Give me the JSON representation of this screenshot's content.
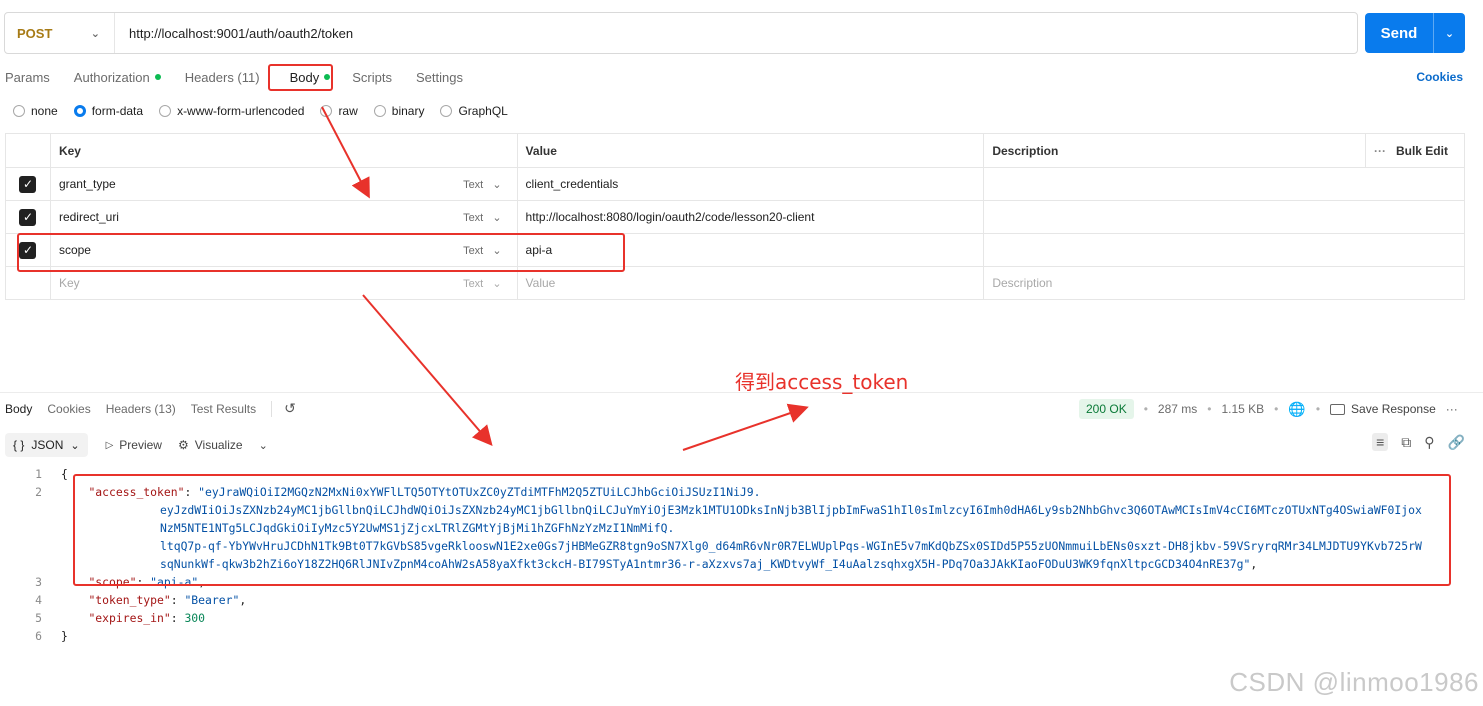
{
  "request": {
    "method": "POST",
    "url": "http://localhost:9001/auth/oauth2/token",
    "send_label": "Send"
  },
  "request_tabs": [
    {
      "label": "Params",
      "dot": false
    },
    {
      "label": "Authorization",
      "dot": true
    },
    {
      "label": "Headers (11)",
      "dot": false
    },
    {
      "label": "Body",
      "dot": true
    },
    {
      "label": "Scripts",
      "dot": false
    },
    {
      "label": "Settings",
      "dot": false
    }
  ],
  "cookies_label": "Cookies",
  "body_types": [
    {
      "label": "none",
      "selected": false
    },
    {
      "label": "form-data",
      "selected": true
    },
    {
      "label": "x-www-form-urlencoded",
      "selected": false
    },
    {
      "label": "raw",
      "selected": false
    },
    {
      "label": "binary",
      "selected": false
    },
    {
      "label": "GraphQL",
      "selected": false
    }
  ],
  "params_table": {
    "headers": {
      "key": "Key",
      "value": "Value",
      "description": "Description",
      "bulk_edit": "Bulk Edit"
    },
    "rows": [
      {
        "key": "grant_type",
        "type": "Text",
        "value": "client_credentials"
      },
      {
        "key": "redirect_uri",
        "type": "Text",
        "value": "http://localhost:8080/login/oauth2/code/lesson20-client"
      },
      {
        "key": "scope",
        "type": "Text",
        "value": "api-a"
      }
    ],
    "placeholder": {
      "key": "Key",
      "type": "Text",
      "value": "Value",
      "description": "Description"
    }
  },
  "annotation": "得到access_token",
  "response": {
    "tabs": [
      "Body",
      "Cookies",
      "Headers (13)",
      "Test Results"
    ],
    "status": "200 OK",
    "time": "287 ms",
    "size": "1.15 KB",
    "save_label": "Save Response",
    "format": "JSON",
    "preview_label": "Preview",
    "visualize_label": "Visualize",
    "json_lines": {
      "l1": "{",
      "l2_key": "\"access_token\"",
      "l2_val": "\"eyJraWQiOiI2MGQzN2MxNi0xYWFlLTQ5OTYtOTUxZC0yZTdiMTFhM2Q5ZTUiLCJhbGciOiJSUzI1NiJ9.",
      "l2b": "eyJzdWIiOiJsZXNzb24yMC1jbGllbnQiLCJhdWQiOiJsZXNzb24yMC1jbGllbnQiLCJuYmYiOjE3Mzk1MTU1ODksInNjb3BlIjpbImFwaS1hIl0sImlzcyI6Imh0dHA6Ly9sb2NhbGhvc3Q6OTAwMCIsImV4cCI6MTczOTUxNTg4OSwiaWF0Ijox",
      "l2c": "NzM5NTE1NTg5LCJqdGkiOiIyMzc5Y2UwMS1jZjcxLTRlZGMtYjBjMi1hZGFhNzYzMzI1NmMifQ.",
      "l2d": "ltqQ7p-qf-YbYWvHruJCDhN1Tk9Bt0T7kGVbS85vgeRklooswN1E2xe0Gs7jHBMeGZR8tgn9oSN7Xlg0_d64mR6vNr0R7ELWUplPqs-WGInE5v7mKdQbZSx0SIDd5P55zUONmmuiLbENs0sxzt-DH8jkbv-59VSryrqRMr34LMJDTU9YKvb725rW",
      "l2e": "sqNunkWf-qkw3b2hZi6oY18Z2HQ6RlJNIvZpnM4coAhW2sA58yaXfkt3ckcH-BI79STyA1ntmr36-r-aXzxvs7aj_KWDtvyWf_I4uAalzsqhxgX5H-PDq7Oa3JAkKIaoFODuU3WK9fqnXltpcGCD34O4nRE37g\"",
      "l3_key": "\"scope\"",
      "l3_val": "\"api-a\"",
      "l4_key": "\"token_type\"",
      "l4_val": "\"Bearer\"",
      "l5_key": "\"expires_in\"",
      "l5_val": "300",
      "l6": "}"
    }
  },
  "watermark": "CSDN @linmoo1986"
}
